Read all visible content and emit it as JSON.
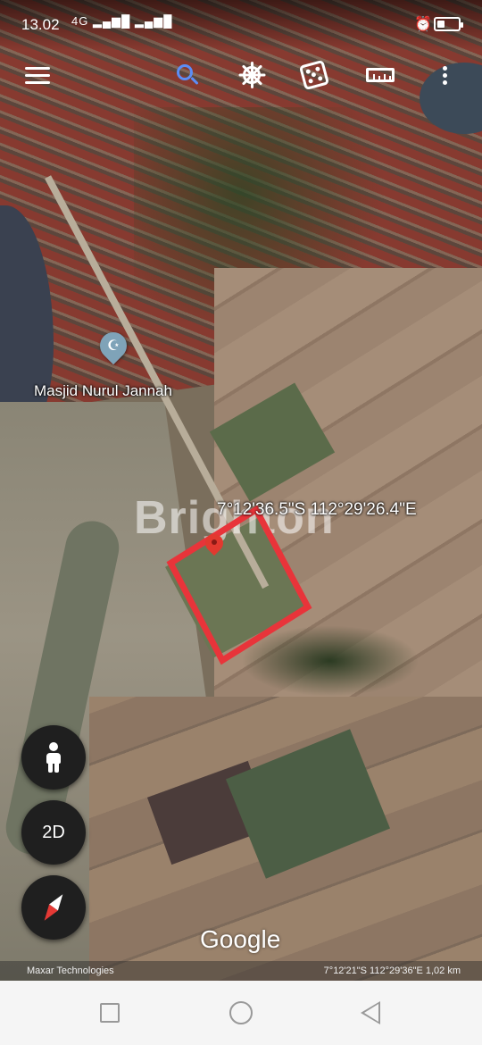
{
  "status_bar": {
    "time": "13.02",
    "signal": "4G",
    "battery_level": 0.35
  },
  "toolbar": {
    "menu": "menu-icon",
    "search": "search-icon",
    "voyager": "ship-wheel-icon",
    "feeling_lucky": "dice-icon",
    "measure": "ruler-icon",
    "more": "more-vert-icon",
    "search_color": "#5c8df6"
  },
  "map": {
    "place_label": "Masjid Nurul Jannah",
    "coordinates": "7°12'36.5\"S 112°29'26.4\"E",
    "watermark": "Brighton",
    "parcel_color": "#e8343a",
    "pin_color": "#e2392f"
  },
  "controls": {
    "street_view": "person-icon",
    "mode_label": "2D",
    "compass": "compass-icon"
  },
  "footer": {
    "logo": "Google",
    "attribution": "Maxar Technologies",
    "scale_info": "7°12'21\"S 112°29'36\"E 1,02 km"
  },
  "nav_bar": {
    "recents": "square-icon",
    "home": "circle-icon",
    "back": "triangle-back-icon"
  }
}
